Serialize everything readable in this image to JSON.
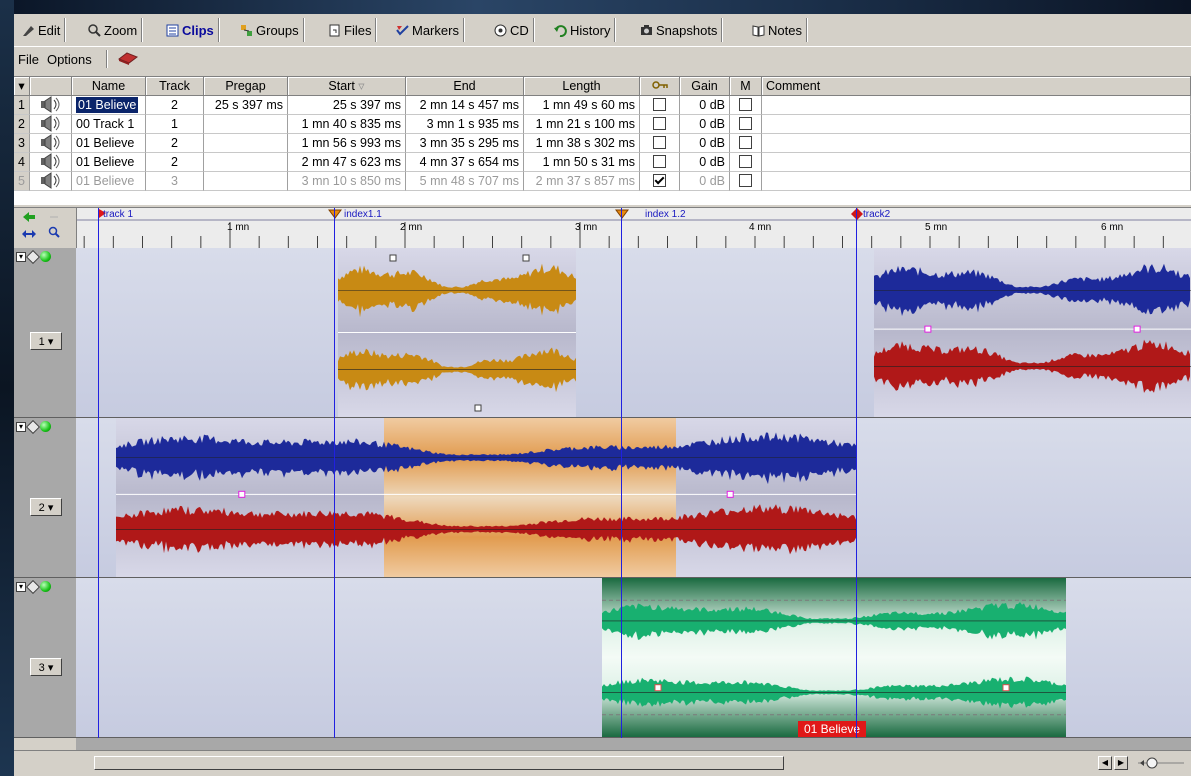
{
  "tabs": [
    {
      "label": "Edit",
      "icon": "edit-icon"
    },
    {
      "label": "Zoom",
      "icon": "zoom-icon"
    },
    {
      "label": "Clips",
      "icon": "clips-icon",
      "active": true
    },
    {
      "label": "Groups",
      "icon": "groups-icon"
    },
    {
      "label": "Files",
      "icon": "files-icon"
    },
    {
      "label": "Markers",
      "icon": "markers-icon"
    },
    {
      "label": "CD",
      "icon": "cd-icon"
    },
    {
      "label": "History",
      "icon": "history-icon"
    },
    {
      "label": "Snapshots",
      "icon": "snapshots-icon"
    },
    {
      "label": "Notes",
      "icon": "notes-icon"
    }
  ],
  "menu": {
    "file": "File",
    "options": "Options",
    "tool_icon": "eraser-icon"
  },
  "grid": {
    "headers": [
      "",
      "Name",
      "Track",
      "Pregap",
      "Start",
      "End",
      "Length",
      "",
      "Gain",
      "M",
      "Comment"
    ],
    "lock_icon": "key-icon",
    "rows": [
      {
        "num": "1",
        "name": "01 Believe",
        "track": "2",
        "pregap": "25 s 397 ms",
        "start": "25 s 397 ms",
        "end": "2 mn 14 s 457 ms",
        "length": "1 mn 49 s 60 ms",
        "locked": false,
        "gain": "0 dB",
        "m": false,
        "selected": true
      },
      {
        "num": "2",
        "name": "00 Track 1",
        "track": "1",
        "pregap": "",
        "start": "1 mn 40 s 835 ms",
        "end": "3 mn 1 s 935 ms",
        "length": "1 mn 21 s 100 ms",
        "locked": false,
        "gain": "0 dB",
        "m": false
      },
      {
        "num": "3",
        "name": "01 Believe",
        "track": "2",
        "pregap": "",
        "start": "1 mn 56 s 993 ms",
        "end": "3 mn 35 s 295 ms",
        "length": "1 mn 38 s 302 ms",
        "locked": false,
        "gain": "0 dB",
        "m": false
      },
      {
        "num": "4",
        "name": "01 Believe",
        "track": "2",
        "pregap": "",
        "start": "2 mn 47 s 623 ms",
        "end": "4 mn 37 s 654 ms",
        "length": "1 mn 50 s 31 ms",
        "locked": false,
        "gain": "0 dB",
        "m": false
      },
      {
        "num": "5",
        "name": "01 Believe",
        "track": "3",
        "pregap": "",
        "start": "3 mn 10 s 850 ms",
        "end": "5 mn 48 s 707 ms",
        "length": "2 mn 37 s 857 ms",
        "locked": true,
        "gain": "0 dB",
        "m": false,
        "faded": true
      }
    ]
  },
  "ruler": {
    "markers": [
      {
        "label": "track 1"
      },
      {
        "label": "index1.1"
      },
      {
        "label": "index 1.2"
      },
      {
        "label": "track2"
      }
    ],
    "ticks": [
      "1 mn",
      "2 mn",
      "3 mn",
      "4 mn",
      "5 mn",
      "6 mn"
    ]
  },
  "tracks": [
    {
      "num": "1"
    },
    {
      "num": "2"
    },
    {
      "num": "3"
    }
  ],
  "clip_label": "01 Believe",
  "colors": {
    "orange": "#c88a14",
    "blue": "#1d2a9a",
    "red": "#b01818",
    "green": "#18b070",
    "highlight": "#f0a050"
  }
}
